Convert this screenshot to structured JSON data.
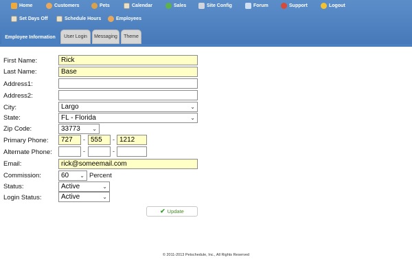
{
  "nav": {
    "row1": [
      {
        "label": "Home",
        "icon": "home-icon",
        "color": "#f1a93a"
      },
      {
        "label": "Customers",
        "icon": "customers-icon",
        "color": "#e8a75a"
      },
      {
        "label": "Pets",
        "icon": "pets-icon",
        "color": "#d9a24a"
      },
      {
        "label": "Calendar",
        "icon": "calendar-icon",
        "color": "#e9e0c8"
      },
      {
        "label": "Sales",
        "icon": "sales-icon",
        "color": "#5fb14a"
      },
      {
        "label": "Site Config",
        "icon": "wrench-icon",
        "color": "#d0d6dc"
      },
      {
        "label": "Forum",
        "icon": "forum-icon",
        "color": "#cfe0f3"
      },
      {
        "label": "Support",
        "icon": "support-icon",
        "color": "#d64a3a"
      },
      {
        "label": "Logout",
        "icon": "key-icon",
        "color": "#f2c230"
      }
    ],
    "row2": [
      {
        "label": "Set Days Off",
        "icon": "days-off-icon",
        "color": "#e9e0c8"
      },
      {
        "label": "Schedule Hours",
        "icon": "schedule-icon",
        "color": "#e9e0c8"
      },
      {
        "label": "Employees",
        "icon": "employees-icon",
        "color": "#e8a75a"
      }
    ]
  },
  "tabs": [
    {
      "label": "Employee Information",
      "active": true
    },
    {
      "label": "User Login",
      "active": false
    },
    {
      "label": "Messaging",
      "active": false
    },
    {
      "label": "Theme",
      "active": false
    }
  ],
  "form": {
    "first_name": {
      "label": "First Name:",
      "value": "Rick"
    },
    "last_name": {
      "label": "Last Name:",
      "value": "Base"
    },
    "address1": {
      "label": "Address1:",
      "value": ""
    },
    "address2": {
      "label": "Address2:",
      "value": ""
    },
    "city": {
      "label": "City:",
      "value": "Largo"
    },
    "state": {
      "label": "State:",
      "value": "FL - Florida"
    },
    "zip": {
      "label": "Zip Code:",
      "value": "33773"
    },
    "primary_phone": {
      "label": "Primary Phone:",
      "area": "727",
      "prefix": "555",
      "line": "1212"
    },
    "alternate_phone": {
      "label": "Alternate Phone:",
      "area": "",
      "prefix": "",
      "line": ""
    },
    "email": {
      "label": "Email:",
      "value": "rick@someemail.com"
    },
    "commission": {
      "label": "Commission:",
      "value": "60",
      "suffix": "Percent"
    },
    "status": {
      "label": "Status:",
      "value": "Active"
    },
    "login_status": {
      "label": "Login Status:",
      "value": "Active"
    },
    "dash": "-"
  },
  "update_label": "Update",
  "footer": "© 2011-2013 Petschedule, Inc., All Rights Reserved"
}
